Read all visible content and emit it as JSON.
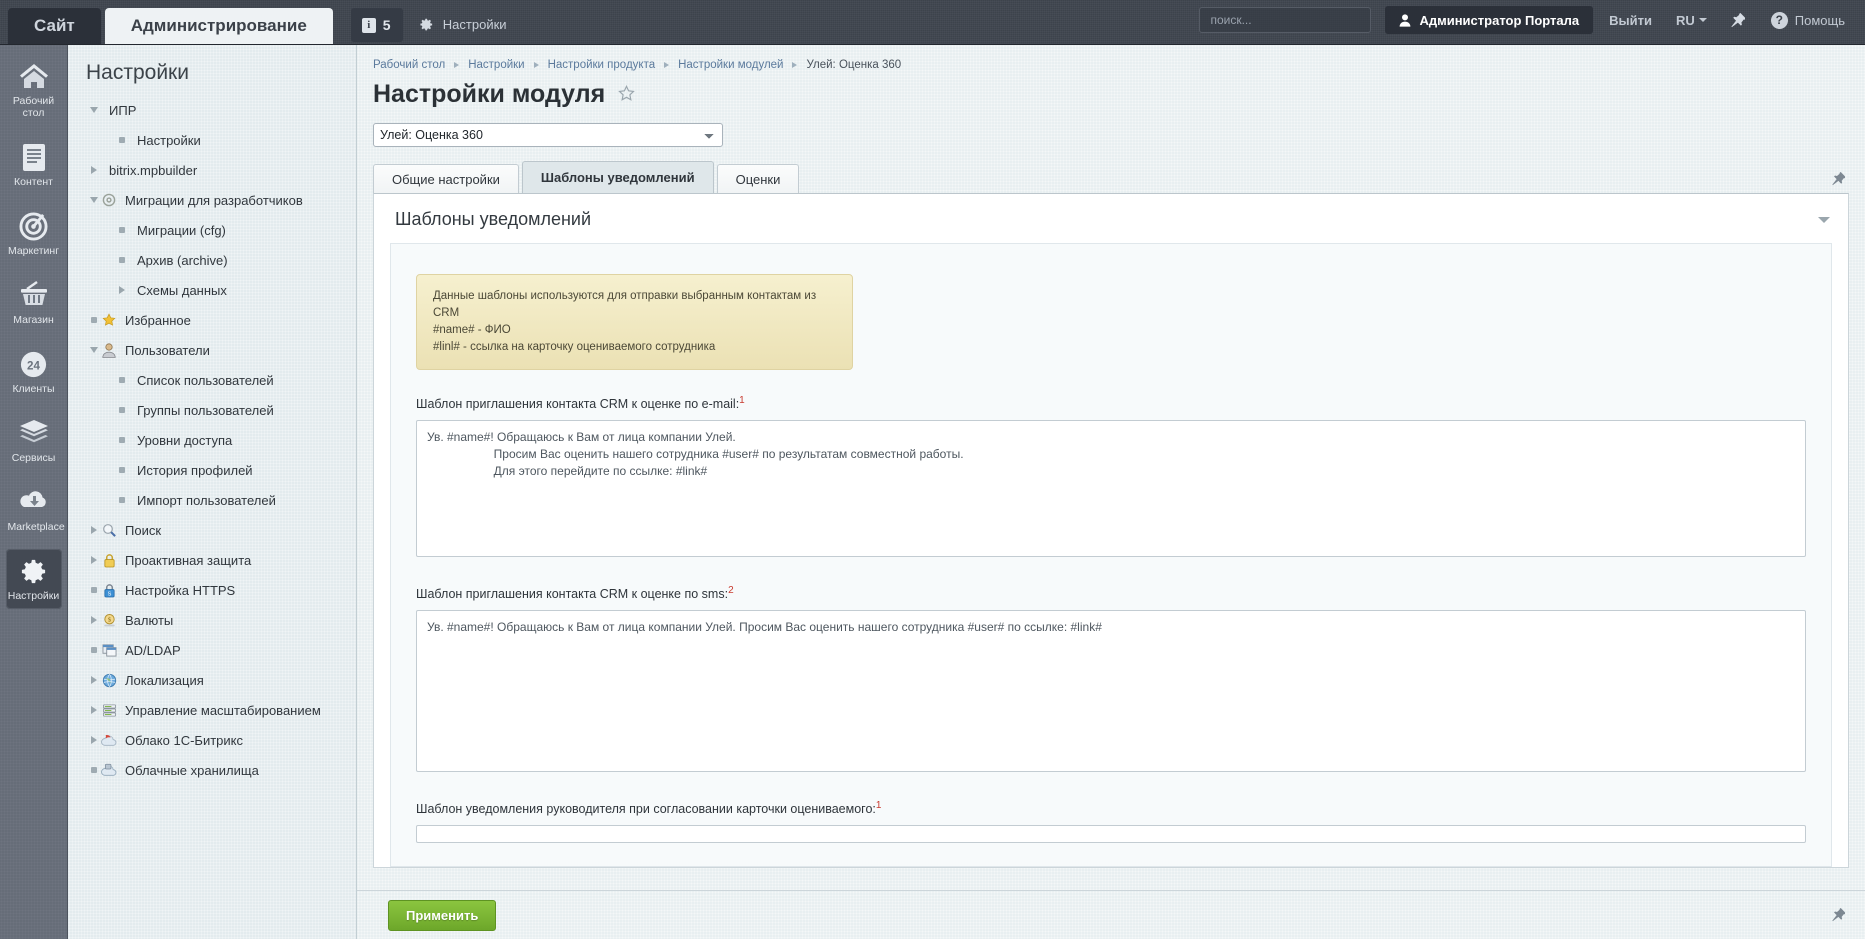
{
  "topbar": {
    "tabs": [
      {
        "label": "Сайт",
        "active": false
      },
      {
        "label": "Администрирование",
        "active": true
      }
    ],
    "badge_count": "5",
    "settings_label": "Настройки",
    "search_placeholder": "поиск...",
    "search_value": "",
    "user_label": "Администратор Портала",
    "logout_label": "Выйти",
    "language_label": "RU",
    "help_label": "Помощь",
    "help_glyph": "?"
  },
  "rail": {
    "items": [
      {
        "label": "Рабочий стол",
        "icon": "home-icon",
        "active": false
      },
      {
        "label": "Контент",
        "icon": "document-icon",
        "active": false
      },
      {
        "label": "Маркетинг",
        "icon": "target-icon",
        "active": false
      },
      {
        "label": "Магазин",
        "icon": "basket-icon",
        "active": false
      },
      {
        "label": "Клиенты",
        "icon": "clients-24-icon",
        "active": false
      },
      {
        "label": "Сервисы",
        "icon": "layers-icon",
        "active": false
      },
      {
        "label": "Marketplace",
        "icon": "cloud-download-icon",
        "active": false
      },
      {
        "label": "Настройки",
        "icon": "gear-icon",
        "active": true
      }
    ]
  },
  "tree": {
    "title": "Настройки",
    "items": [
      {
        "label": "ИПР",
        "level": 1,
        "marker": "arrow-d",
        "icon": ""
      },
      {
        "label": "Настройки",
        "level": 2,
        "marker": "bullet",
        "icon": ""
      },
      {
        "label": "bitrix.mpbuilder",
        "level": 1,
        "marker": "arrow-r",
        "icon": ""
      },
      {
        "label": "Миграции для разработчиков",
        "level": 1,
        "marker": "arrow-d",
        "icon": "gear-small-icon"
      },
      {
        "label": "Миграции (cfg)",
        "level": 2,
        "marker": "bullet",
        "icon": ""
      },
      {
        "label": "Архив (archive)",
        "level": 2,
        "marker": "bullet",
        "icon": ""
      },
      {
        "label": "Схемы данных",
        "level": 2,
        "marker": "arrow-r",
        "icon": ""
      },
      {
        "label": "Избранное",
        "level": 1,
        "marker": "bullet",
        "icon": "star-icon"
      },
      {
        "label": "Пользователи",
        "level": 1,
        "marker": "arrow-d",
        "icon": "user-icon"
      },
      {
        "label": "Список пользователей",
        "level": 2,
        "marker": "bullet",
        "icon": ""
      },
      {
        "label": "Группы пользователей",
        "level": 2,
        "marker": "bullet",
        "icon": ""
      },
      {
        "label": "Уровни доступа",
        "level": 2,
        "marker": "bullet",
        "icon": ""
      },
      {
        "label": "История профилей",
        "level": 2,
        "marker": "bullet",
        "icon": ""
      },
      {
        "label": "Импорт пользователей",
        "level": 2,
        "marker": "bullet",
        "icon": ""
      },
      {
        "label": "Поиск",
        "level": 1,
        "marker": "arrow-r",
        "icon": "magnifier-icon"
      },
      {
        "label": "Проактивная защита",
        "level": 1,
        "marker": "arrow-r",
        "icon": "lock-icon"
      },
      {
        "label": "Настройка HTTPS",
        "level": 1,
        "marker": "bullet",
        "icon": "lock-blue-icon"
      },
      {
        "label": "Валюты",
        "level": 1,
        "marker": "arrow-r",
        "icon": "coin-icon"
      },
      {
        "label": "AD/LDAP",
        "level": 1,
        "marker": "bullet",
        "icon": "window-icon"
      },
      {
        "label": "Локализация",
        "level": 1,
        "marker": "arrow-r",
        "icon": "globe-icon"
      },
      {
        "label": "Управление масштабированием",
        "level": 1,
        "marker": "arrow-r",
        "icon": "server-icon"
      },
      {
        "label": "Облако 1С-Битрикс",
        "level": 1,
        "marker": "arrow-r",
        "icon": "cloud-red-icon"
      },
      {
        "label": "Облачные хранилища",
        "level": 1,
        "marker": "bullet",
        "icon": "cloud-storage-icon"
      }
    ]
  },
  "breadcrumbs": [
    {
      "label": "Рабочий стол",
      "link": true
    },
    {
      "label": "Настройки",
      "link": true
    },
    {
      "label": "Настройки продукта",
      "link": true
    },
    {
      "label": "Настройки модулей",
      "link": true
    },
    {
      "label": "Улей: Оценка 360",
      "link": false
    }
  ],
  "page": {
    "title": "Настройки модуля",
    "module_selected": "Улей: Оценка 360",
    "module_options": [
      "Улей: Оценка 360"
    ]
  },
  "tabs": [
    {
      "label": "Общие настройки",
      "active": false
    },
    {
      "label": "Шаблоны уведомлений",
      "active": true
    },
    {
      "label": "Оценки",
      "active": false
    }
  ],
  "section": {
    "heading": "Шаблоны уведомлений",
    "note_lines": [
      "Данные шаблоны используются для отправки выбранным контактам из CRM",
      "#name# - ФИО",
      "#linl# - ссылка на карточку оцениваемого сотрудника"
    ],
    "fields": [
      {
        "label": "Шаблон приглашения контакта CRM к оценке по e-mail:",
        "required_mark": "1",
        "value": "Ув. #name#! Обращаюсь к Вам от лица компании Улей.\n                    Просим Вас оценить нашего сотрудника #user# по результатам совместной работы.\n                    Для этого перейдите по ссылке: #link#"
      },
      {
        "label": "Шаблон приглашения контакта CRM к оценке по sms:",
        "required_mark": "2",
        "value": "Ув. #name#! Обращаюсь к Вам от лица компании Улей. Просим Вас оценить нашего сотрудника #user# по ссылке: #link#"
      },
      {
        "label": "Шаблон уведомления руководителя при согласовании карточки оцениваемого:",
        "required_mark": "1",
        "value": ""
      }
    ]
  },
  "footer": {
    "apply_label": "Применить"
  },
  "colors": {
    "topbar_bg": "#3f454f",
    "rail_bg": "#666d78",
    "panel_bg": "#e3ebee",
    "accent_green": "#6da72a",
    "link_blue": "#5b7a9c",
    "note_bg": "#f1e9c4",
    "required_red": "#c83a2e"
  }
}
